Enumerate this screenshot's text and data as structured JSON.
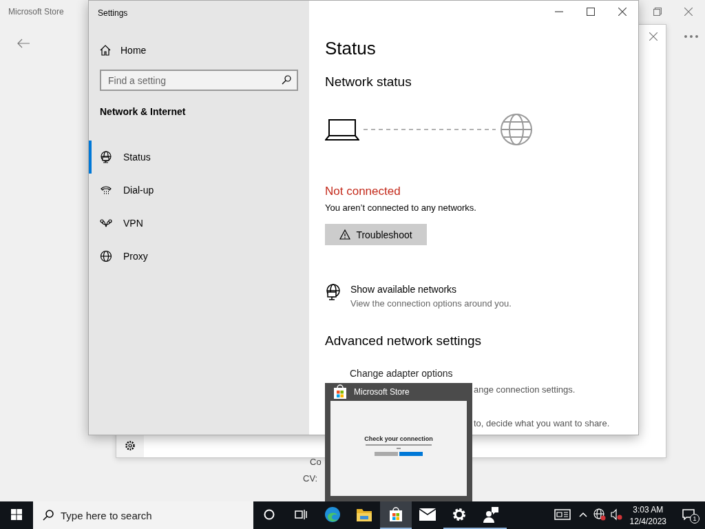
{
  "store_window": {
    "title": "Microsoft Store",
    "behind_lines": [
      "Co",
      "CV:"
    ]
  },
  "settings": {
    "title": "Settings",
    "home": "Home",
    "search": {
      "placeholder": "Find a setting"
    },
    "section": "Network & Internet",
    "nav": [
      {
        "label": "Status",
        "kind": "status",
        "selected": true
      },
      {
        "label": "Dial-up",
        "kind": "dialup",
        "selected": false
      },
      {
        "label": "VPN",
        "kind": "vpn",
        "selected": false
      },
      {
        "label": "Proxy",
        "kind": "proxy",
        "selected": false
      }
    ],
    "page_title": "Status",
    "network_heading": "Network status",
    "connection": {
      "connected": false,
      "status": "Not connected",
      "message": "You aren’t connected to any networks.",
      "button": "Troubleshoot"
    },
    "link": {
      "title": "Show available networks",
      "description": "View the connection options around you."
    },
    "advanced_heading": "Advanced network settings",
    "advanced": [
      {
        "title": "Change adapter options",
        "description": "ange connection settings."
      },
      {
        "description": "to, decide what you want to share."
      }
    ]
  },
  "thumbnail": {
    "title": "Microsoft Store",
    "preview_heading": "Check your connection"
  },
  "taskbar": {
    "search_placeholder": "Type here to search",
    "apps": [
      {
        "kind": "edge",
        "running": false,
        "selected": false
      },
      {
        "kind": "explorer",
        "running": false,
        "selected": false
      },
      {
        "kind": "store",
        "running": true,
        "selected": true
      },
      {
        "kind": "mail",
        "running": false,
        "selected": false
      },
      {
        "kind": "settings",
        "running": true,
        "selected": false
      },
      {
        "kind": "feedback",
        "running": true,
        "selected": false
      }
    ],
    "time": "3:03 AM",
    "date": "12/4/2023",
    "notifications": "1"
  }
}
